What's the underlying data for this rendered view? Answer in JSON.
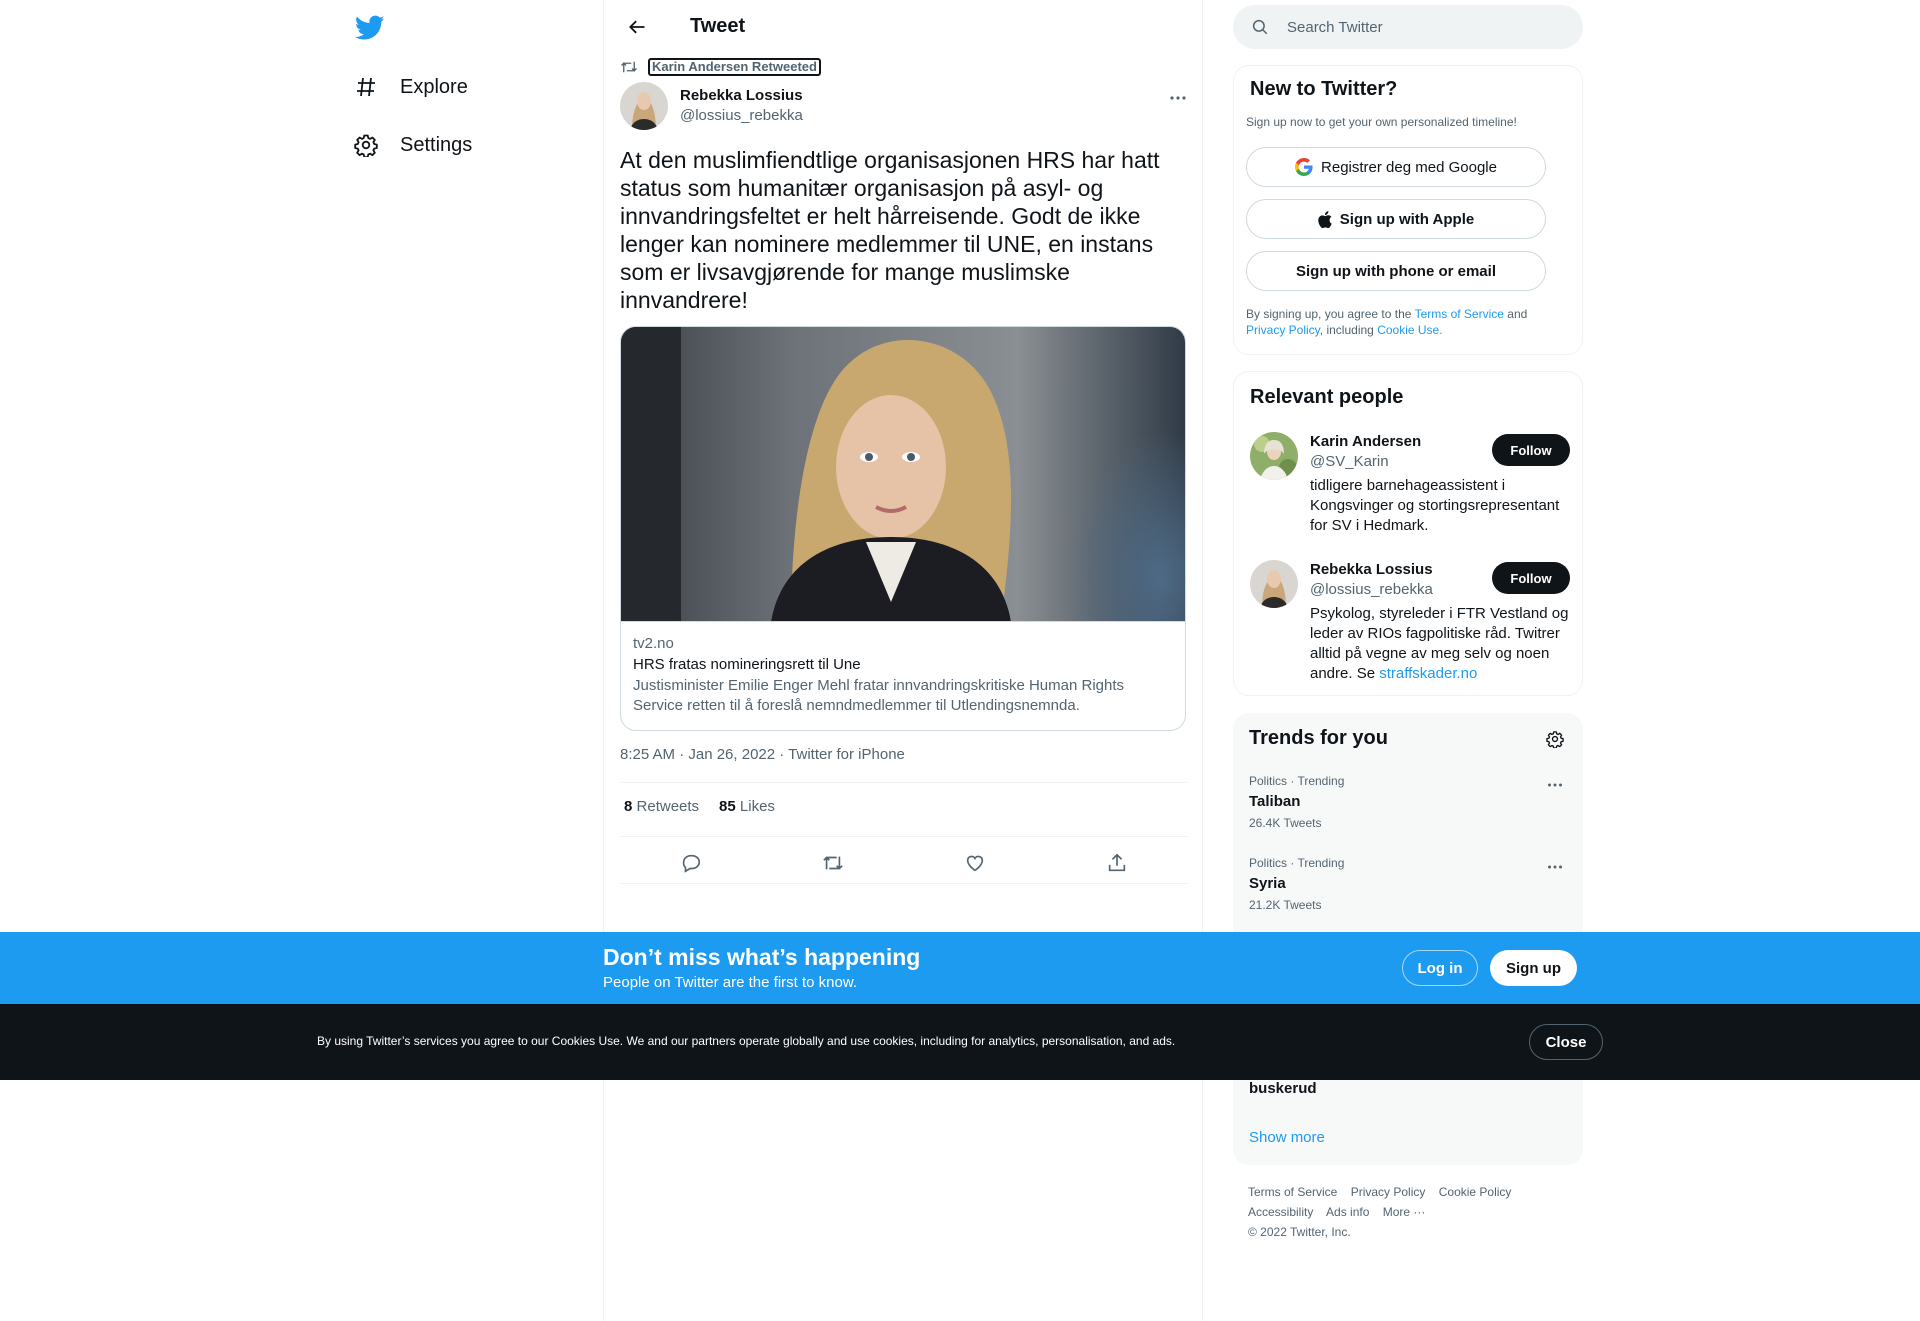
{
  "nav": {
    "logo_icon": "twitter-bird-icon",
    "items": [
      {
        "label": "Explore",
        "icon": "hashtag-icon"
      },
      {
        "label": "Settings",
        "icon": "gear-icon"
      }
    ]
  },
  "header": {
    "title": "Tweet",
    "back_icon": "arrow-left-icon"
  },
  "tweet": {
    "retweet_context": "Karin Andersen Retweeted",
    "author_name": "Rebekka Lossius",
    "author_handle": "@lossius_rebekka",
    "text": "At den muslimfiendtlige organisasjonen HRS har hatt status som humanitær organisasjon på asyl- og innvandringsfeltet er helt hårreisende. Godt de ikke lenger kan nominere medlemmer til UNE, en instans som er livsavgjørende for mange muslimske innvandrere!",
    "card": {
      "domain": "tv2.no",
      "title": "HRS fratas nomineringsrett til Une",
      "description": "Justisminister Emilie Enger Mehl fratar innvandringskritiske Human Rights Service retten til å foreslå nemndmedlemmer til Utlendingsnemnda."
    },
    "timestamp": "8:25 AM · Jan 26, 2022 · Twitter for iPhone",
    "retweets_count": "8",
    "retweets_label": "Retweets",
    "likes_count": "85",
    "likes_label": "Likes"
  },
  "search": {
    "placeholder": "Search Twitter"
  },
  "new_to_twitter": {
    "title": "New to Twitter?",
    "subtitle": "Sign up now to get your own personalized timeline!",
    "google_label": "Registrer deg med Google",
    "apple_label": "Sign up with Apple",
    "phone_label": "Sign up with phone or email",
    "legal_prefix": "By signing up, you agree to the",
    "terms": "Terms of Service",
    "and": "and",
    "privacy": "Privacy Policy",
    "including": ", including",
    "cookie": "Cookie Use."
  },
  "relevant_people": {
    "title": "Relevant people",
    "people": [
      {
        "name": "Karin Andersen",
        "handle": "@SV_Karin",
        "bio": "tidligere barnehageassistent i Kongsvinger og stortingsrepresentant for SV i Hedmark.",
        "follow": "Follow"
      },
      {
        "name": "Rebekka Lossius",
        "handle": "@lossius_rebekka",
        "bio": "Psykolog, styreleder i FTR Vestland og leder av RIOs fagpolitiske råd. Twitrer alltid på vegne av meg selv og noen andre. Se",
        "bio_link": "straffskader.no",
        "follow": "Follow"
      }
    ]
  },
  "trends": {
    "title": "Trends for you",
    "items": [
      {
        "meta": "Politics · Trending",
        "name": "Taliban",
        "count": "26.4K Tweets"
      },
      {
        "meta": "Politics · Trending",
        "name": "Syria",
        "count": "21.2K Tweets"
      }
    ],
    "partial_item": "buskerud",
    "show_more": "Show more"
  },
  "footer": {
    "links": [
      "Terms of Service",
      "Privacy Policy",
      "Cookie Policy",
      "Accessibility",
      "Ads info",
      "More ···"
    ],
    "copyright": "© 2022 Twitter, Inc."
  },
  "login_bar": {
    "title": "Don’t miss what’s happening",
    "subtitle": "People on Twitter are the first to know.",
    "login": "Log in",
    "signup": "Sign up"
  },
  "cookie_bar": {
    "text": "By using Twitter’s services you agree to our Cookies Use. We and our partners operate globally and use cookies, including for analytics, personalisation, and ads.",
    "close": "Close"
  },
  "colors": {
    "accent": "#1d9bf0",
    "text": "#0f1419",
    "muted": "#536471",
    "cookie_bg": "#0f1419"
  }
}
